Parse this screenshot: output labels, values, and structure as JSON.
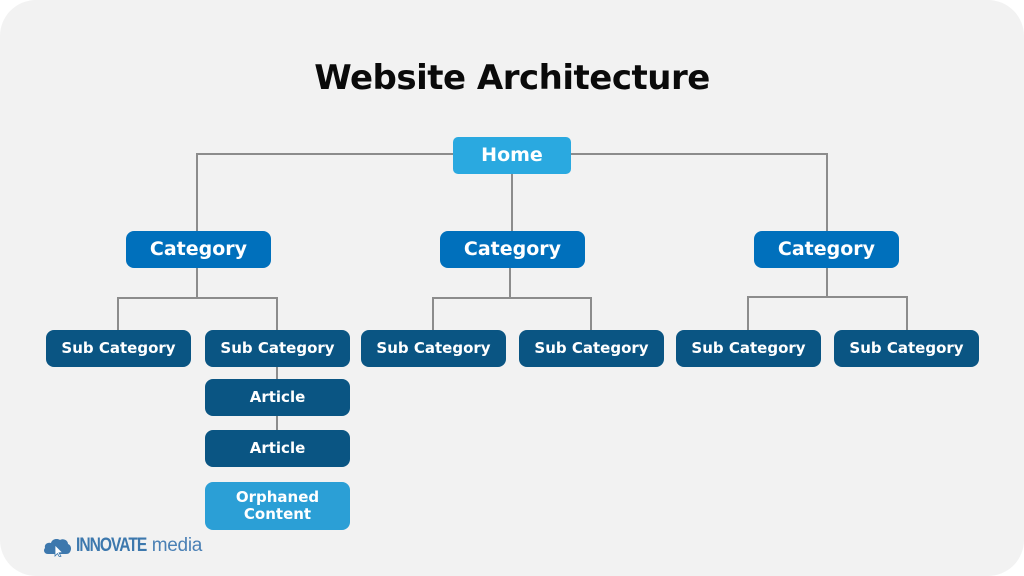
{
  "title": "Website Architecture",
  "colors": {
    "background": "#f2f2f2",
    "home": "#2aa9e0",
    "category": "#0070bc",
    "subcategory": "#0a5583",
    "article": "#0a5583",
    "orphan": "#2b9fd6",
    "connector": "#8c8c8c",
    "logo": "#3d78ad"
  },
  "home": {
    "label": "Home"
  },
  "categories": [
    {
      "label": "Category",
      "subcategories": [
        {
          "label": "Sub Category"
        },
        {
          "label": "Sub Category",
          "articles": [
            {
              "label": "Article"
            },
            {
              "label": "Article"
            }
          ]
        }
      ]
    },
    {
      "label": "Category",
      "subcategories": [
        {
          "label": "Sub Category"
        },
        {
          "label": "Sub Category"
        }
      ]
    },
    {
      "label": "Category",
      "subcategories": [
        {
          "label": "Sub Category"
        },
        {
          "label": "Sub Category"
        }
      ]
    }
  ],
  "orphaned": {
    "label": "Orphaned Content"
  },
  "logo": {
    "icon": "cloud-cursor-icon",
    "brand": "INNOVATE",
    "suffix": "media"
  }
}
